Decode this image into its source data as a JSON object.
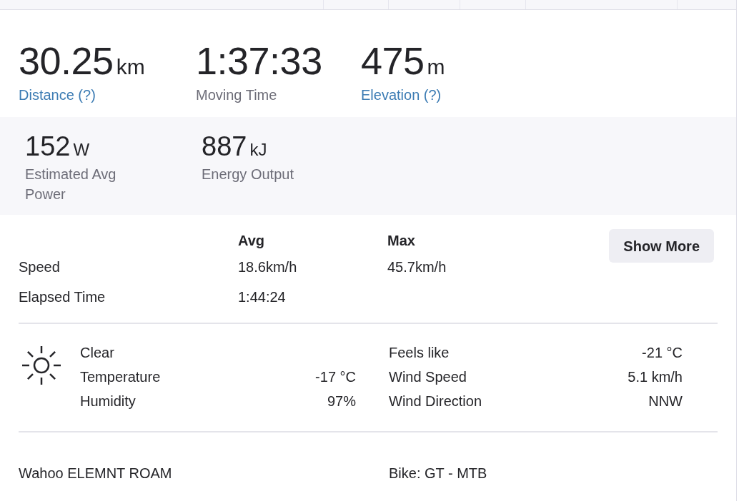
{
  "top_stats": [
    {
      "value": "30.25",
      "unit": "km",
      "label": "Distance (?)",
      "kind": "link"
    },
    {
      "value": "1:37:33",
      "label": "Moving Time",
      "kind": "plain"
    },
    {
      "value": "475",
      "unit": "m",
      "label": "Elevation (?)",
      "kind": "link"
    }
  ],
  "secondary_stats": [
    {
      "value": "152",
      "unit": "W",
      "label": "Estimated Avg Power"
    },
    {
      "value": "887",
      "unit": "kJ",
      "label": "Energy Output"
    }
  ],
  "stats_table": {
    "columns": [
      "Avg",
      "Max"
    ],
    "rows": [
      {
        "label": "Speed",
        "avg": "18.6km/h",
        "max": "45.7km/h"
      },
      {
        "label": "Elapsed Time",
        "avg": "1:44:24"
      }
    ]
  },
  "show_more_button": "Show More",
  "weather": {
    "left": [
      {
        "label": "Clear"
      },
      {
        "label": "Temperature",
        "value": "-17 °C"
      },
      {
        "label": "Humidity",
        "value": "97%"
      }
    ],
    "right": [
      {
        "label": "Feels like",
        "value": "-21 °C"
      },
      {
        "label": "Wind Speed",
        "value": "5.1 km/h"
      },
      {
        "label": "Wind Direction",
        "value": "NNW"
      }
    ]
  },
  "gear": {
    "device": "Wahoo ELEMNT ROAM",
    "bike": "Bike: GT - MTB"
  }
}
